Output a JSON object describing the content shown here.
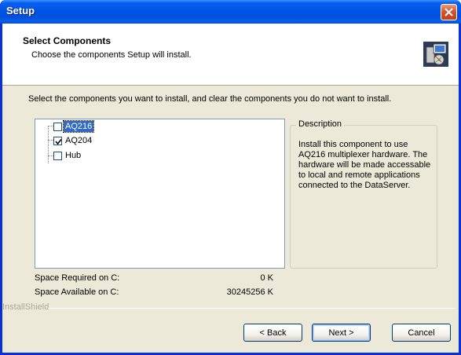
{
  "window": {
    "title": "Setup"
  },
  "header": {
    "title": "Select Components",
    "subtitle": "Choose the components Setup will install."
  },
  "instruction": "Select the components you want to install, and clear the components you do not want to install.",
  "components": [
    {
      "label": "AQ216",
      "checked": false,
      "selected": true
    },
    {
      "label": "AQ204",
      "checked": true,
      "selected": false
    },
    {
      "label": "Hub",
      "checked": false,
      "selected": false
    }
  ],
  "description": {
    "legend": "Description",
    "text": "Install this component to use AQ216 multiplexer hardware. The hardware will be made accessable to local and remote applications connected to the DataServer."
  },
  "space": {
    "required_label": "Space Required on  C:",
    "required_value": "0 K",
    "available_label": "Space Available on  C:",
    "available_value": "30245256 K"
  },
  "footer": {
    "brand": "InstallShield"
  },
  "buttons": {
    "back": "< Back",
    "next": "Next >",
    "cancel": "Cancel"
  }
}
